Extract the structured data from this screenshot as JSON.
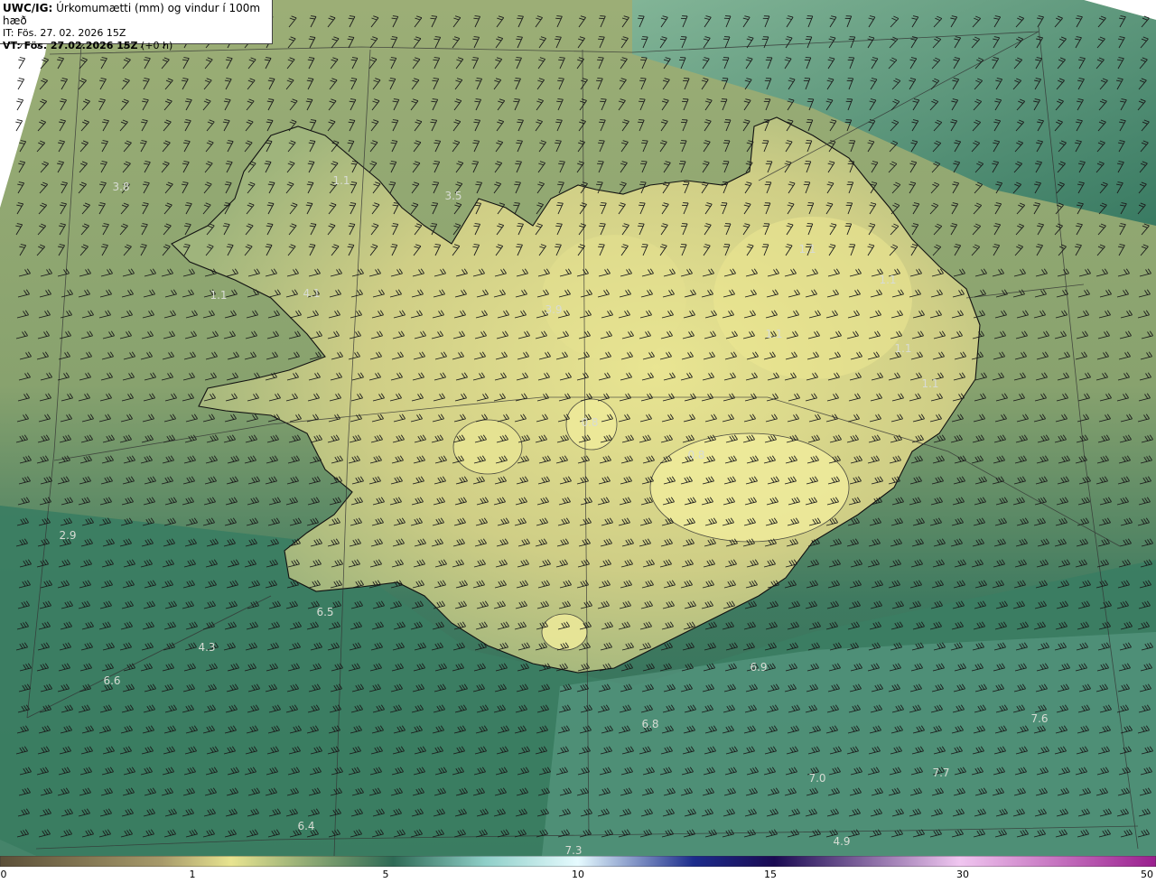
{
  "header": {
    "model": "UWC/IG:",
    "title": "Úrkomumætti (mm) og vindur í 100m hæð",
    "init_time": "IT: Fös. 27. 02. 2026 15Z",
    "valid_label": "VT: Fös. 27.02.2026 15Z",
    "lead": "(+0 h)"
  },
  "values": [
    "3.8",
    "3.5",
    "4.1",
    "3.9",
    "2.9",
    "6.5",
    "4.3",
    "6.6",
    "6.9",
    "6.8",
    "7.6",
    "7.0",
    "7.7",
    "6.4",
    "7.3",
    "4.9",
    "1.1",
    "1.1",
    "1.1",
    "1.1",
    "0.8",
    "0.8",
    "1.1",
    "1.1",
    "1.1"
  ],
  "colorbar": {
    "ticks": [
      "0",
      "1",
      "5",
      "10",
      "15",
      "30",
      "50"
    ],
    "colors": [
      "#5b4f38",
      "#a79a6a",
      "#e8e490",
      "#2e6a55",
      "#8fcfc8",
      "#e6fbff",
      "#1c2c8c",
      "#1a0a52",
      "#f0c6f0",
      "#9a1e8e"
    ]
  },
  "map_colors": {
    "sea_deep": "#2e6e58",
    "sea_mid": "#5a8f6c",
    "land_low": "#9fb07a",
    "land_high": "#e6e28e",
    "coast": "#111111"
  }
}
